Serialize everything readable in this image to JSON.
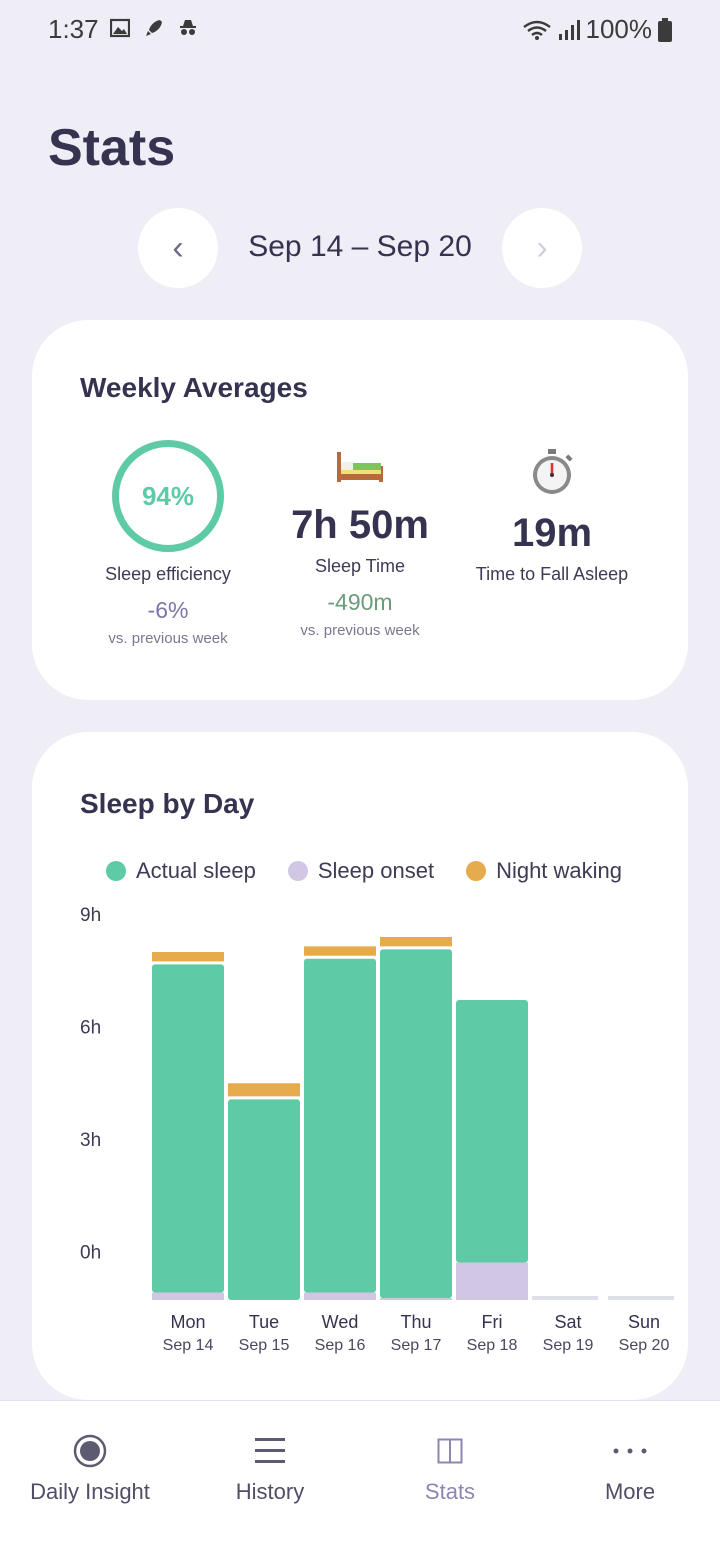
{
  "status_bar": {
    "time": "1:37",
    "battery": "100%"
  },
  "page": {
    "title": "Stats"
  },
  "week_nav": {
    "prev": "‹",
    "next": "›",
    "range": "Sep 14 – Sep 20"
  },
  "weekly_averages": {
    "title": "Weekly Averages",
    "efficiency": {
      "value": "94%",
      "fraction": 0.94,
      "label": "Sleep efficiency",
      "change": "-6%",
      "compare": "vs. previous week"
    },
    "sleep_time": {
      "value": "7h 50m",
      "label": "Sleep Time",
      "change": "-490m",
      "compare": "vs. previous week"
    },
    "time_to_fall_asleep": {
      "value": "19m",
      "label": "Time to Fall Asleep"
    }
  },
  "sleep_by_day": {
    "title": "Sleep by Day",
    "legend": {
      "actual": "Actual sleep",
      "onset": "Sleep onset",
      "waking": "Night waking"
    }
  },
  "colors": {
    "actual": "#5ecba6",
    "onset": "#d1c6e4",
    "waking": "#e6ab4c",
    "accent": "#8a87b3"
  },
  "chart_data": {
    "type": "bar",
    "stacked": true,
    "yticks": [
      "9h",
      "6h",
      "3h",
      "0h"
    ],
    "ylim": [
      -1.3,
      9
    ],
    "categories": [
      {
        "day": "Mon",
        "date": "Sep 14"
      },
      {
        "day": "Tue",
        "date": "Sep 15"
      },
      {
        "day": "Wed",
        "date": "Sep 16"
      },
      {
        "day": "Thu",
        "date": "Sep 17"
      },
      {
        "day": "Fri",
        "date": "Sep 18"
      },
      {
        "day": "Sat",
        "date": "Sep 19"
      },
      {
        "day": "Sun",
        "date": "Sep 20"
      }
    ],
    "series": [
      {
        "name": "Sleep onset",
        "values": [
          0.2,
          0,
          0.2,
          0.05,
          1.0,
          0,
          0
        ]
      },
      {
        "name": "Actual sleep",
        "values": [
          8.75,
          5.35,
          8.9,
          9.3,
          7.0,
          0,
          0
        ]
      },
      {
        "name": "Night waking",
        "values": [
          0.25,
          0.35,
          0.25,
          0.25,
          0,
          0,
          0
        ]
      }
    ]
  },
  "bottom_nav": [
    {
      "label": "Daily Insight",
      "icon": "target-icon"
    },
    {
      "label": "History",
      "icon": "list-icon"
    },
    {
      "label": "Stats",
      "icon": "stats-icon",
      "active": true
    },
    {
      "label": "More",
      "icon": "more-icon"
    }
  ]
}
